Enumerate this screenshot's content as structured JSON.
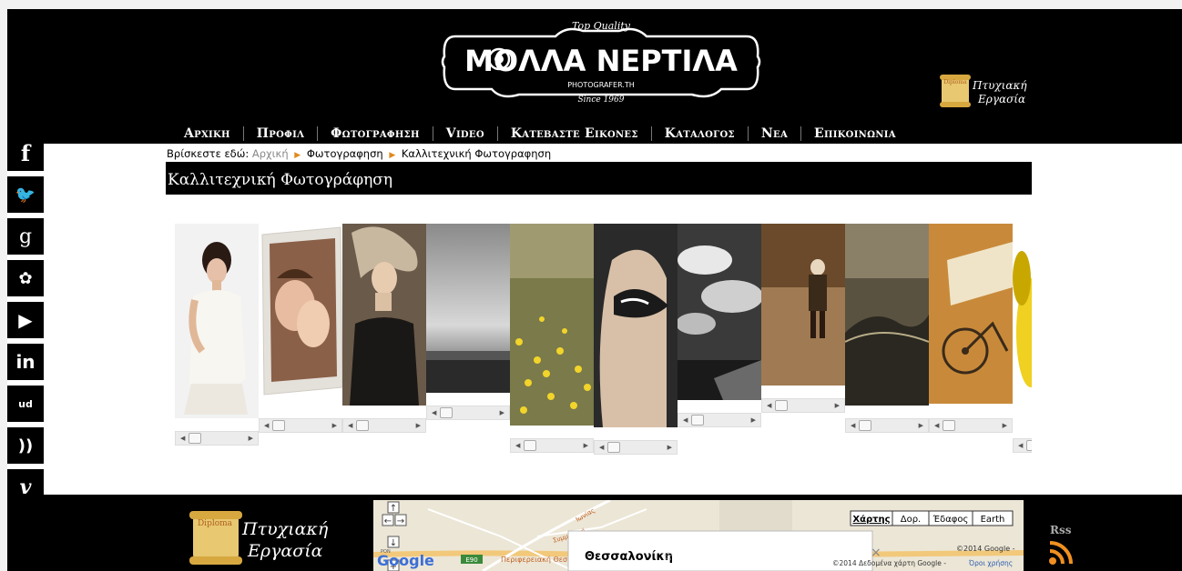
{
  "logo": {
    "top_text": "Top Quality",
    "name": "ΜΟΛΛΑ ΝΕΡΤΙΛΑ",
    "sub": "PHOTOGRAFER.TH",
    "since": "Since 1969"
  },
  "diploma": {
    "badge": "Diploma",
    "line1": "Πτυχιακή",
    "line2": "Εργασία"
  },
  "nav": {
    "items": [
      "Αρχικη",
      "Προφιλ",
      "Φωτογραφηση",
      "Video",
      "Κατεβαστε Εικονες",
      "Καταλογος",
      "Νεα",
      "Επικοινωνια"
    ]
  },
  "social": {
    "icons": [
      "facebook-icon",
      "twitter-icon",
      "google-plus-icon",
      "myspace-icon",
      "youtube-icon",
      "linkedin-icon",
      "soundcloud-icon",
      "rss-icon",
      "vimeo-icon"
    ],
    "glyphs": [
      "f",
      "🐦",
      "g",
      "✿",
      "▶",
      "in",
      "ud",
      "))",
      "v"
    ]
  },
  "breadcrumb": {
    "prefix": "Βρίσκεστε εδώ:",
    "home": "Αρχική",
    "section": "Φωτογραφηση",
    "current": "Καλλιτεχνική Φωτογραφηση"
  },
  "page_title": "Καλλιτεχνική Φωτογράφηση",
  "gallery": {
    "photos": [
      "portrait-woman-white-dress",
      "couple-framed",
      "woman-leather-dress",
      "misty-waterfall",
      "yellow-flower-field",
      "masked-face",
      "dramatic-clouds",
      "man-walking-sepia",
      "wave-water",
      "bicycle-sign",
      "yellow-flower-closeup"
    ]
  },
  "map": {
    "type_buttons": [
      "Χάρτης",
      "Δορ.",
      "Έδαφος",
      "Earth"
    ],
    "city": "Θεσσαλονίκη",
    "star": "☆",
    "copyright": "©2014 Google -",
    "data_credit": "©2014 Δεδομένα χάρτη Google -",
    "terms": "Όροι χρήσης",
    "google": "Google",
    "road1": "Συμμαχική",
    "road2": "Περιφερειακή Θεσ",
    "road3": "Ιωνίας",
    "e90": "E90",
    "label_rows": "ΡΟΝ"
  },
  "footer": {
    "rss_label": "Rss"
  },
  "colors": {
    "accent": "#e08a1e",
    "black": "#000000"
  }
}
